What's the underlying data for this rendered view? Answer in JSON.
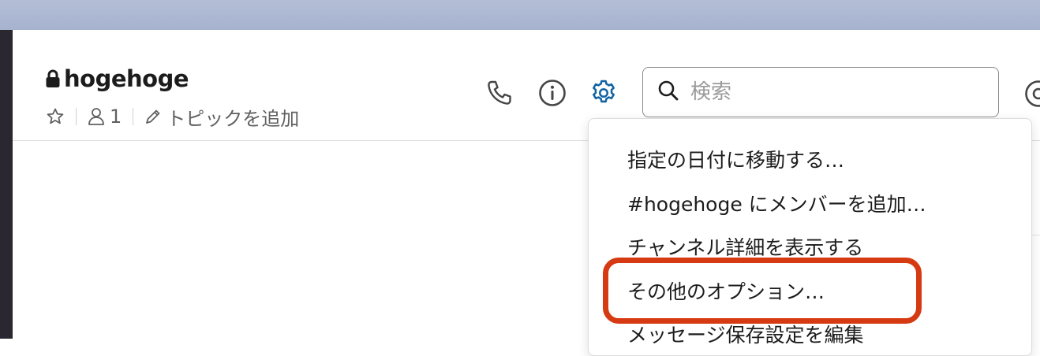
{
  "channel": {
    "name": "hogehoge",
    "member_count": "1",
    "topic_placeholder": "トピックを追加"
  },
  "toolbar": {
    "icons": [
      "phone-icon",
      "info-icon",
      "gear-icon"
    ],
    "gear_color": "#1264a3"
  },
  "search": {
    "placeholder": "検索"
  },
  "dropdown_menu": {
    "items": [
      "指定の日付に移動する…",
      "#hogehoge にメンバーを追加…",
      "チャンネル詳細を表示する",
      "その他のオプション…",
      "メッセージ保存設定を編集"
    ],
    "highlighted_item_index": 3,
    "highlight_color": "#d63a12"
  }
}
